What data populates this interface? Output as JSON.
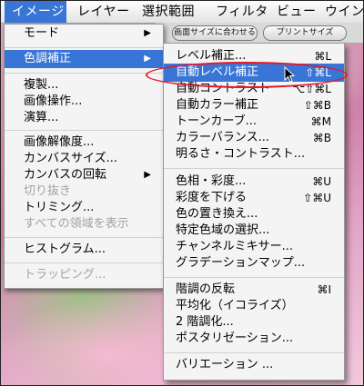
{
  "menubar": {
    "items": [
      "イメージ",
      "レイヤー",
      "選択範囲",
      "フィルタ",
      "ビュー",
      "ウインド"
    ]
  },
  "toolbar": {
    "btn1": "画面サイズに合わせる",
    "btn2": "プリントサイズ"
  },
  "image_menu": {
    "items": [
      {
        "label": "モード",
        "submenu": "▶"
      },
      {
        "label": "色調補正",
        "submenu": "▶"
      },
      {
        "label": "複製..."
      },
      {
        "label": "画像操作..."
      },
      {
        "label": "演算..."
      },
      {
        "label": "画像解像度..."
      },
      {
        "label": "カンバスサイズ..."
      },
      {
        "label": "カンバスの回転",
        "submenu": "▶"
      },
      {
        "label": "切り抜き"
      },
      {
        "label": "トリミング..."
      },
      {
        "label": "すべての領域を表示"
      },
      {
        "label": "ヒストグラム..."
      },
      {
        "label": "トラッピング..."
      }
    ]
  },
  "adjust_menu": {
    "items": [
      {
        "label": "レベル補正...",
        "shortcut": "⌘L"
      },
      {
        "label": "自動レベル補正",
        "shortcut": "⇧⌘L"
      },
      {
        "label": "自動コントラスト",
        "shortcut": "⌥⇧⌘L"
      },
      {
        "label": "自動カラー補正",
        "shortcut": "⇧⌘B"
      },
      {
        "label": "トーンカーブ...",
        "shortcut": "⌘M"
      },
      {
        "label": "カラーバランス...",
        "shortcut": "⌘B"
      },
      {
        "label": "明るさ・コントラスト..."
      },
      {
        "label": "色相・彩度...",
        "shortcut": "⌘U"
      },
      {
        "label": "彩度を下げる",
        "shortcut": "⇧⌘U"
      },
      {
        "label": "色の置き換え..."
      },
      {
        "label": "特定色域の選択..."
      },
      {
        "label": "チャンネルミキサー..."
      },
      {
        "label": "グラデーションマップ..."
      },
      {
        "label": "階調の反転",
        "shortcut": "⌘I"
      },
      {
        "label": "平均化（イコライズ）"
      },
      {
        "label": "2 階調化..."
      },
      {
        "label": "ポスタリゼーション..."
      },
      {
        "label": "バリエーション ..."
      }
    ]
  },
  "colors": {
    "highlight": "#3875d7",
    "callout": "#e2182a"
  }
}
